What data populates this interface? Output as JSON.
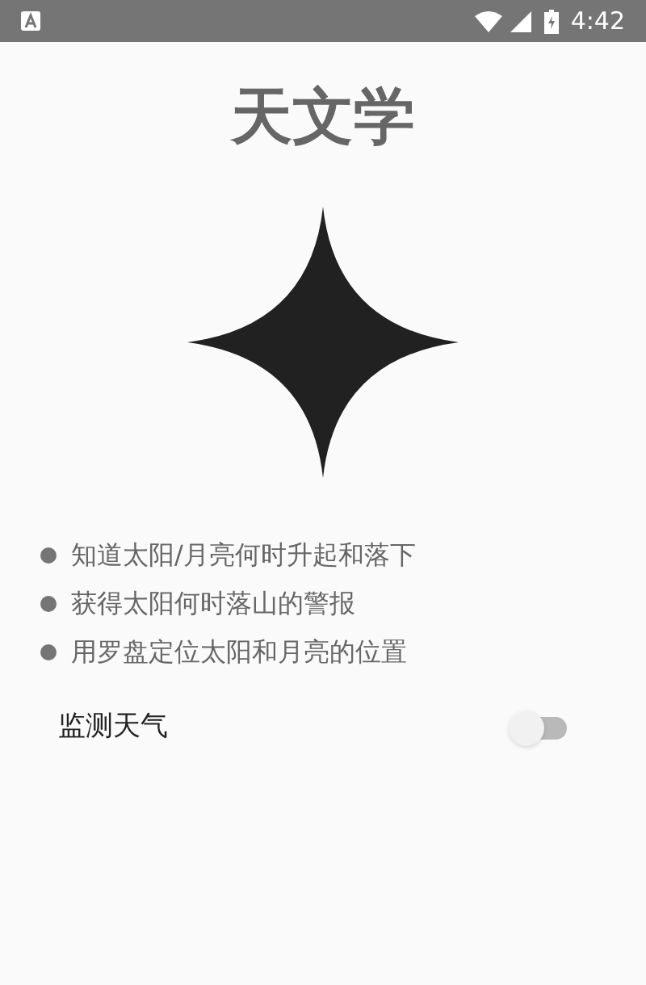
{
  "status_bar": {
    "time": "4:42"
  },
  "title": "天文学",
  "features": [
    "知道太阳/月亮何时升起和落下",
    "获得太阳何时落山的警报",
    "用罗盘定位太阳和月亮的位置"
  ],
  "setting": {
    "label": "监测天气",
    "on": false
  }
}
